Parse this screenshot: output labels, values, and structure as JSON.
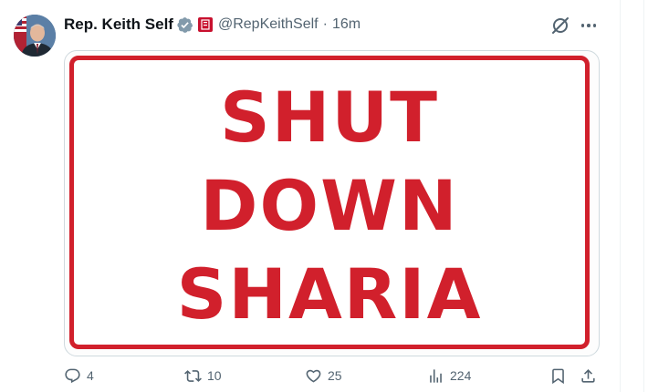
{
  "author": {
    "name": "Rep. Keith Self",
    "handle": "@RepKeithSelf",
    "separator": "·",
    "time": "16m"
  },
  "media": {
    "line1": "SHUT",
    "line2": "DOWN",
    "line3": "SHARIA"
  },
  "actions": {
    "replies": "4",
    "retweets": "10",
    "likes": "25",
    "views": "224"
  },
  "colors": {
    "sign_red": "#d1202c",
    "verified_gray": "#829aab",
    "gov_badge_red": "#c8102e",
    "icon_gray": "#536471"
  }
}
